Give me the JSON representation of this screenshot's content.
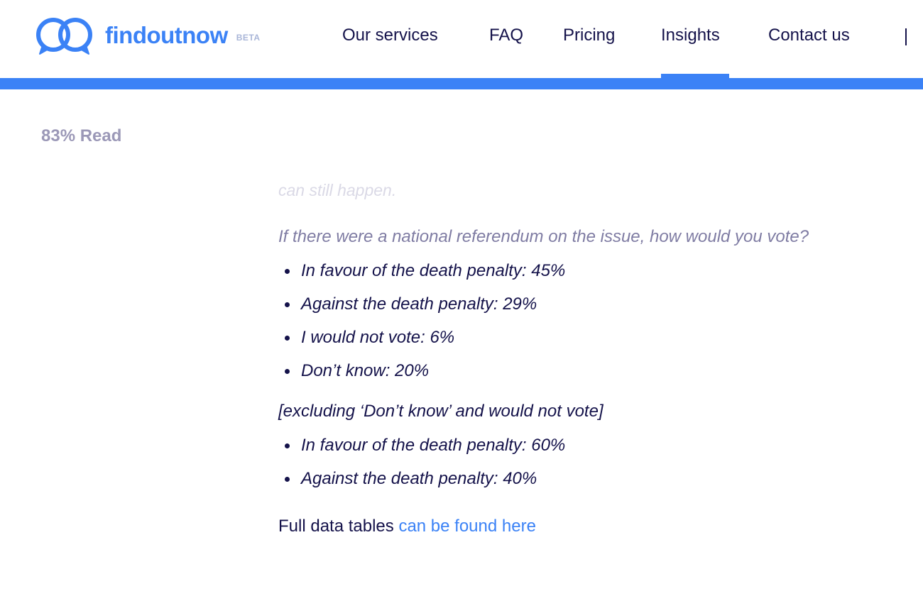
{
  "header": {
    "brand": {
      "name": "findoutnow",
      "badge": "BETA"
    },
    "nav": {
      "items": [
        {
          "label": "Our services",
          "active": false
        },
        {
          "label": "FAQ",
          "active": false
        },
        {
          "label": "Pricing",
          "active": false
        },
        {
          "label": "Insights",
          "active": true
        },
        {
          "label": "Contact us",
          "active": false
        }
      ]
    }
  },
  "progress": {
    "percent_read": 83,
    "label": "83% Read"
  },
  "article": {
    "faded_text": "can still happen.",
    "question": "If there were a national referendum on the issue, how would you vote?",
    "results": [
      "In favour of the death penalty: 45%",
      "Against the death penalty: 29%",
      "I would not vote: 6%",
      "Don’t know: 20%"
    ],
    "excluding_note": "[excluding ‘Don’t know’ and would not vote]",
    "results_excluding": [
      "In favour of the death penalty: 60%",
      "Against the death penalty: 40%"
    ],
    "data_tables_prefix": "Full data tables ",
    "data_tables_link": "can be found here"
  },
  "colors": {
    "accent": "#3b82f6",
    "text_dark": "#14124a",
    "text_muted": "#7f7ca3",
    "progress_text": "#9b98b7",
    "faded_text": "#dad9e6",
    "badge": "#a9b6d8"
  },
  "icons": {
    "logo": "speech-bubbles-logo-icon"
  }
}
